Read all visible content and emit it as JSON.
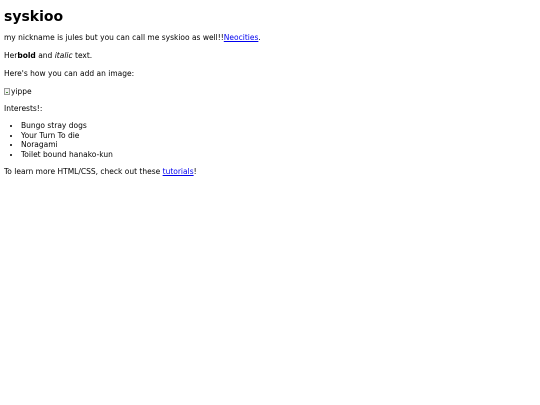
{
  "heading": "syskioo",
  "intro": {
    "text": "my nickname is jules but you can call me syskioo as well!!",
    "link_label": "Neocities",
    "suffix": "."
  },
  "formatting": {
    "prefix": "Her",
    "bold": "bold",
    "middle": " and ",
    "italic": "italic",
    "suffix": " text."
  },
  "image_intro": "Here's how you can add an image:",
  "image": {
    "alt": "yippe",
    "icon": "broken-image-icon"
  },
  "interests": {
    "label": "Interests!:",
    "items": [
      "Bungo stray dogs",
      "Your Turn To die",
      "Noragami",
      "Toilet bound hanako-kun"
    ]
  },
  "footer": {
    "prefix": "To learn more HTML/CSS, check out these ",
    "link_label": "tutorials",
    "suffix": "!"
  }
}
